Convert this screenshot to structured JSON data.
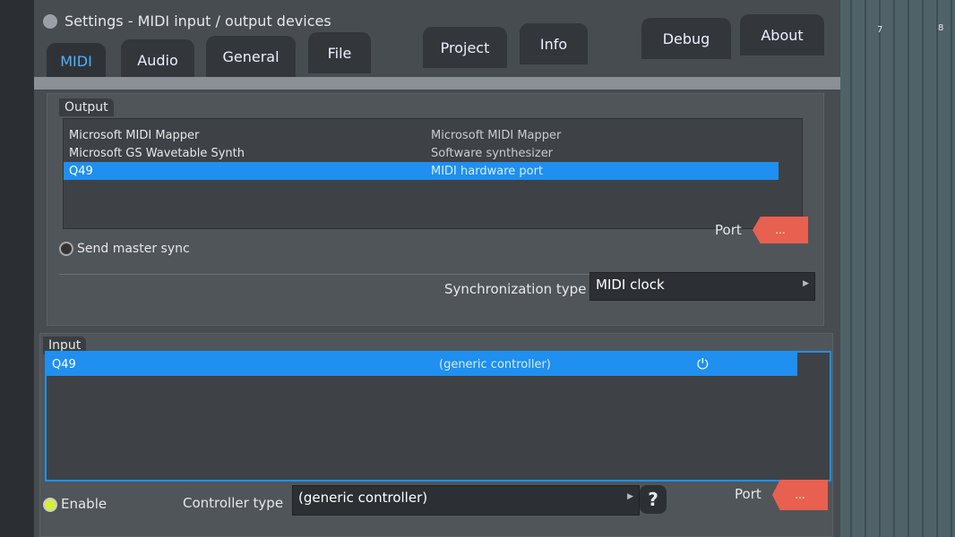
{
  "window": {
    "title": "Settings - MIDI input / output devices"
  },
  "tabs": [
    {
      "label": "MIDI",
      "active": true
    },
    {
      "label": "Audio"
    },
    {
      "label": "General"
    },
    {
      "label": "File"
    },
    {
      "label": "Project"
    },
    {
      "label": "Info"
    },
    {
      "label": "Debug"
    },
    {
      "label": "About"
    }
  ],
  "output": {
    "label": "Output",
    "devices": [
      {
        "name": "Microsoft MIDI Mapper",
        "desc": "Microsoft MIDI Mapper"
      },
      {
        "name": "Microsoft GS Wavetable Synth",
        "desc": "Software synthesizer"
      },
      {
        "name": "Q49",
        "desc": "MIDI hardware port",
        "selected": true
      }
    ],
    "send_master_sync": "Send master sync",
    "port_label": "Port",
    "port_value": "...",
    "sync_label": "Synchronization type",
    "sync_value": "MIDI clock"
  },
  "input": {
    "label": "Input",
    "devices": [
      {
        "name": "Q49",
        "desc": "(generic controller)",
        "selected": true
      }
    ],
    "enable_label": "Enable",
    "controller_type_label": "Controller type",
    "controller_type_value": "(generic controller)",
    "help": "?",
    "port_label": "Port",
    "port_value": "..."
  },
  "background": {
    "col7": "7",
    "col8": "8"
  },
  "colors": {
    "accent": "#1f8ff0",
    "port": "#e8604f",
    "enable": "#d4ef3a"
  }
}
